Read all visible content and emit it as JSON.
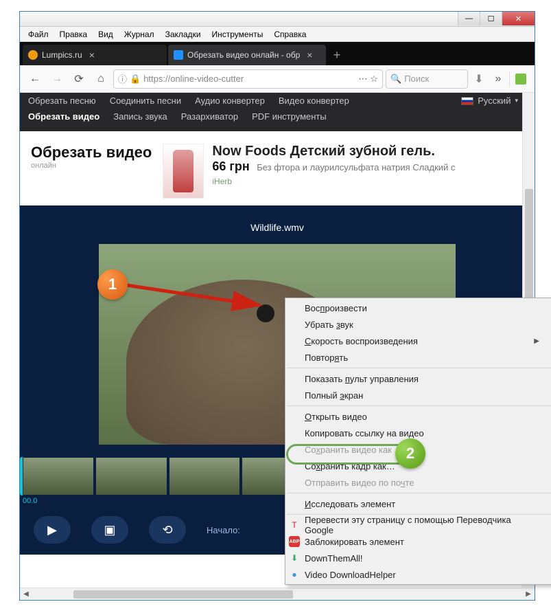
{
  "menubar": [
    "Файл",
    "Правка",
    "Вид",
    "Журнал",
    "Закладки",
    "Инструменты",
    "Справка"
  ],
  "tabs": [
    {
      "label": "Lumpics.ru",
      "favicon": "#f39c12"
    },
    {
      "label": "Обрезать видео онлайн - обр",
      "favicon": "#1e90ff"
    }
  ],
  "url": "https://online-video-cutter",
  "search_placeholder": "Поиск",
  "sitenav": {
    "row1": [
      "Обрезать песню",
      "Соединить песни",
      "Аудио конвертер",
      "Видео конвертер"
    ],
    "row2": [
      "Обрезать видео",
      "Запись звука",
      "Разархиватор",
      "PDF инструменты"
    ],
    "lang": "Русский"
  },
  "page_title": "Обрезать видео",
  "page_subtitle": "онлайн",
  "ad": {
    "title": "Now Foods Детский зубной гель.",
    "price": "66 грн",
    "desc": "Без фтора и лаурилсульфата натрия Сладкий с",
    "source": "iHerb"
  },
  "filename": "Wildlife.wmv",
  "time_start": "00.0",
  "controls_label": "Начало:",
  "context_menu": [
    {
      "label": "Воспроизвести",
      "u": "п"
    },
    {
      "label": "Убрать звук",
      "u": "з"
    },
    {
      "label": "Скорость воспроизведения",
      "u": "С",
      "submenu": true
    },
    {
      "label": "Повторять",
      "u": "я"
    },
    {
      "sep": true
    },
    {
      "label": "Показать пульт управления",
      "u": "п"
    },
    {
      "label": "Полный экран",
      "u": "э"
    },
    {
      "sep": true
    },
    {
      "label": "Открыть видео",
      "u": "О"
    },
    {
      "label": "Копировать ссылку на видео",
      "u": "д"
    },
    {
      "label": "Сохранить видео как",
      "u": "х",
      "greyed": true
    },
    {
      "label": "Сохранить кадр как…",
      "u": "х",
      "highlight": true
    },
    {
      "label": "Отправить видео по почте",
      "u": "ч",
      "greyed": true
    },
    {
      "sep": true
    },
    {
      "label": "Исследовать элемент",
      "u": "И"
    },
    {
      "sep": true
    },
    {
      "label": "Перевести эту страницу с помощью Переводчика Google",
      "icon": "T",
      "iconcolor": "#d14"
    },
    {
      "label": "Заблокировать элемент",
      "icon": "ABP",
      "iconbg": "#d33"
    },
    {
      "label": "DownThemAll!",
      "icon": "⬇",
      "iconcolor": "#3a6"
    },
    {
      "label": "Video DownloadHelper",
      "icon": "●",
      "iconcolor": "#39d"
    }
  ],
  "markers": {
    "m1": "1",
    "m2": "2"
  }
}
